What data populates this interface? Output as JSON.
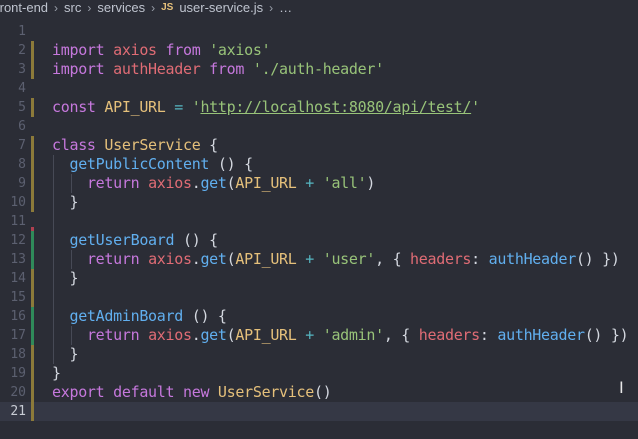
{
  "breadcrumb": {
    "items": [
      "front-end",
      "src",
      "services"
    ],
    "file_icon": "JS",
    "file_name": "user-service.js",
    "trailing": "…"
  },
  "editor": {
    "current_line": 21,
    "lines": [
      {
        "n": "1",
        "git": "",
        "tokens": []
      },
      {
        "n": "2",
        "git": "modified",
        "tokens": [
          [
            "kw",
            "import"
          ],
          [
            "pun",
            " "
          ],
          [
            "id",
            "axios"
          ],
          [
            "pun",
            " "
          ],
          [
            "kw",
            "from"
          ],
          [
            "pun",
            " "
          ],
          [
            "str",
            "'axios'"
          ]
        ]
      },
      {
        "n": "3",
        "git": "modified",
        "tokens": [
          [
            "kw",
            "import"
          ],
          [
            "pun",
            " "
          ],
          [
            "id",
            "authHeader"
          ],
          [
            "pun",
            " "
          ],
          [
            "kw",
            "from"
          ],
          [
            "pun",
            " "
          ],
          [
            "str",
            "'./auth-header'"
          ]
        ]
      },
      {
        "n": "4",
        "git": "",
        "tokens": []
      },
      {
        "n": "5",
        "git": "modified",
        "tokens": [
          [
            "kw",
            "const"
          ],
          [
            "pun",
            " "
          ],
          [
            "cls",
            "API_URL"
          ],
          [
            "pun",
            " "
          ],
          [
            "op",
            "="
          ],
          [
            "pun",
            " "
          ],
          [
            "str",
            "'"
          ],
          [
            "url",
            "http://localhost:8080/api/test/"
          ],
          [
            "str",
            "'"
          ]
        ]
      },
      {
        "n": "6",
        "git": "",
        "tokens": []
      },
      {
        "n": "7",
        "git": "modified",
        "tokens": [
          [
            "kw",
            "class"
          ],
          [
            "pun",
            " "
          ],
          [
            "cls",
            "UserService"
          ],
          [
            "pun",
            " {"
          ]
        ]
      },
      {
        "n": "8",
        "git": "modified",
        "tokens": [
          [
            "pun",
            "  "
          ],
          [
            "fn",
            "getPublicContent"
          ],
          [
            "pun",
            " () {"
          ]
        ]
      },
      {
        "n": "9",
        "git": "modified",
        "tokens": [
          [
            "pun",
            "    "
          ],
          [
            "kw",
            "return"
          ],
          [
            "pun",
            " "
          ],
          [
            "id",
            "axios"
          ],
          [
            "pun",
            "."
          ],
          [
            "fn",
            "get"
          ],
          [
            "pun",
            "("
          ],
          [
            "cls",
            "API_URL"
          ],
          [
            "pun",
            " "
          ],
          [
            "op",
            "+"
          ],
          [
            "pun",
            " "
          ],
          [
            "str",
            "'all'"
          ],
          [
            "pun",
            ")"
          ]
        ]
      },
      {
        "n": "10",
        "git": "modified",
        "tokens": [
          [
            "pun",
            "  }"
          ]
        ]
      },
      {
        "n": "11",
        "git": "deleted",
        "tokens": []
      },
      {
        "n": "12",
        "git": "added",
        "tokens": [
          [
            "pun",
            "  "
          ],
          [
            "fn",
            "getUserBoard"
          ],
          [
            "pun",
            " () {"
          ]
        ]
      },
      {
        "n": "13",
        "git": "added",
        "tokens": [
          [
            "pun",
            "    "
          ],
          [
            "kw",
            "return"
          ],
          [
            "pun",
            " "
          ],
          [
            "id",
            "axios"
          ],
          [
            "pun",
            "."
          ],
          [
            "fn",
            "get"
          ],
          [
            "pun",
            "("
          ],
          [
            "cls",
            "API_URL"
          ],
          [
            "pun",
            " "
          ],
          [
            "op",
            "+"
          ],
          [
            "pun",
            " "
          ],
          [
            "str",
            "'user'"
          ],
          [
            "pun",
            ", { "
          ],
          [
            "prop",
            "headers"
          ],
          [
            "pun",
            ": "
          ],
          [
            "fn",
            "authHeader"
          ],
          [
            "pun",
            "() })"
          ]
        ]
      },
      {
        "n": "14",
        "git": "modified",
        "tokens": [
          [
            "pun",
            "  }"
          ]
        ]
      },
      {
        "n": "15",
        "git": "modified",
        "tokens": []
      },
      {
        "n": "16",
        "git": "added",
        "tokens": [
          [
            "pun",
            "  "
          ],
          [
            "fn",
            "getAdminBoard"
          ],
          [
            "pun",
            " () {"
          ]
        ]
      },
      {
        "n": "17",
        "git": "added",
        "tokens": [
          [
            "pun",
            "    "
          ],
          [
            "kw",
            "return"
          ],
          [
            "pun",
            " "
          ],
          [
            "id",
            "axios"
          ],
          [
            "pun",
            "."
          ],
          [
            "fn",
            "get"
          ],
          [
            "pun",
            "("
          ],
          [
            "cls",
            "API_URL"
          ],
          [
            "pun",
            " "
          ],
          [
            "op",
            "+"
          ],
          [
            "pun",
            " "
          ],
          [
            "str",
            "'admin'"
          ],
          [
            "pun",
            ", { "
          ],
          [
            "prop",
            "headers"
          ],
          [
            "pun",
            ": "
          ],
          [
            "fn",
            "authHeader"
          ],
          [
            "pun",
            "() })"
          ]
        ]
      },
      {
        "n": "18",
        "git": "modified",
        "tokens": [
          [
            "pun",
            "  }"
          ]
        ]
      },
      {
        "n": "19",
        "git": "modified",
        "tokens": [
          [
            "pun",
            "}"
          ]
        ]
      },
      {
        "n": "20",
        "git": "modified",
        "tokens": [
          [
            "kw",
            "export"
          ],
          [
            "pun",
            " "
          ],
          [
            "kw",
            "default"
          ],
          [
            "pun",
            " "
          ],
          [
            "kw",
            "new"
          ],
          [
            "pun",
            " "
          ],
          [
            "cls",
            "UserService"
          ],
          [
            "pun",
            "()"
          ]
        ]
      },
      {
        "n": "21",
        "git": "modified",
        "tokens": []
      }
    ]
  },
  "colors": {
    "git_modified": "#8c7a3a",
    "git_added": "#2f8a5a",
    "git_deleted": "#b04050"
  },
  "cursor_icon": "text-cursor-icon"
}
